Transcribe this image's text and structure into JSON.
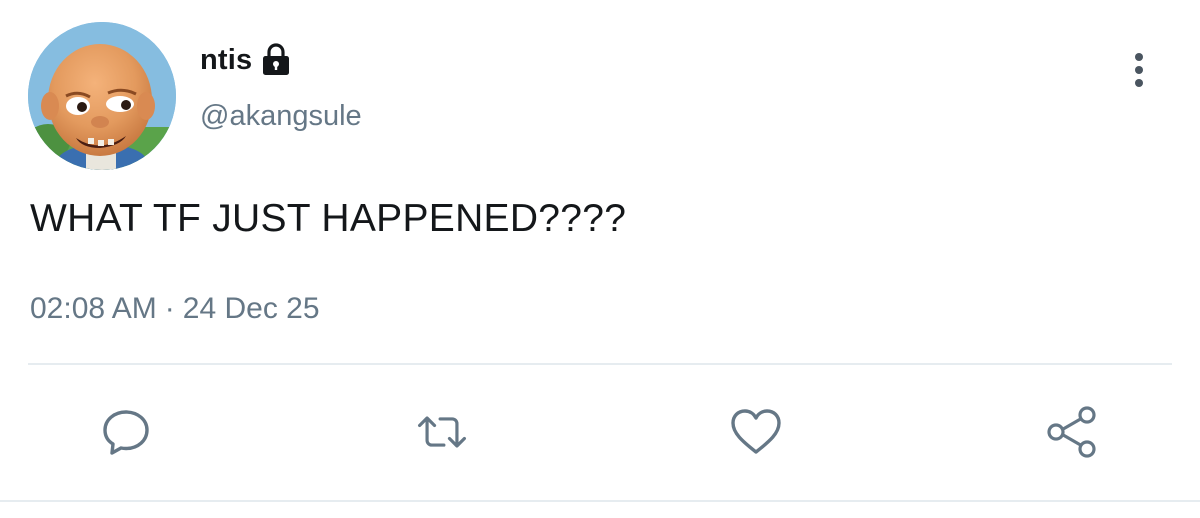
{
  "user": {
    "display_name": "ntis",
    "handle": "@akangsule",
    "protected_icon": "lock-icon",
    "avatar": "avatar-image"
  },
  "tweet": {
    "text": "WHAT TF JUST HAPPENED????",
    "time": "02:08 AM",
    "separator": "·",
    "date": "24 Dec 25"
  },
  "actions": [
    {
      "icon": "reply-icon"
    },
    {
      "icon": "retweet-icon"
    },
    {
      "icon": "like-icon"
    },
    {
      "icon": "share-icon"
    }
  ],
  "menu_icon": "more-options-icon",
  "colors": {
    "text_primary": "#14171a",
    "text_secondary": "#657786",
    "icon": "#657786",
    "divider": "#e6ecf0"
  }
}
